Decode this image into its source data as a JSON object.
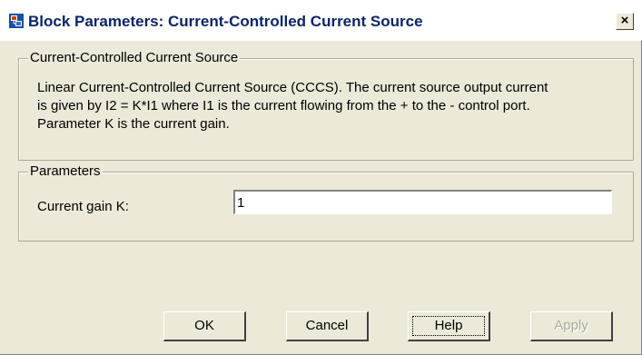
{
  "window": {
    "title": "Block Parameters: Current-Controlled Current Source",
    "close_glyph": "×"
  },
  "description_group": {
    "legend": "Current-Controlled Current Source",
    "lines": [
      "Linear Current-Controlled Current Source (CCCS). The current source output current",
      "is given by I2 = K*I1 where I1 is the current flowing from the + to the - control port.",
      "Parameter K is the current gain."
    ]
  },
  "parameters_group": {
    "legend": "Parameters",
    "current_gain_label": "Current gain K:",
    "current_gain_value": "1"
  },
  "buttons": {
    "ok": "OK",
    "cancel": "Cancel",
    "help": "Help",
    "apply": "Apply"
  },
  "icons": {
    "app_icon": "simulink-block-icon",
    "close_icon": "close-icon"
  },
  "colors": {
    "title_text": "#0a246a",
    "dialog_bg": "#ece9d8",
    "disabled_text": "#aca899"
  }
}
